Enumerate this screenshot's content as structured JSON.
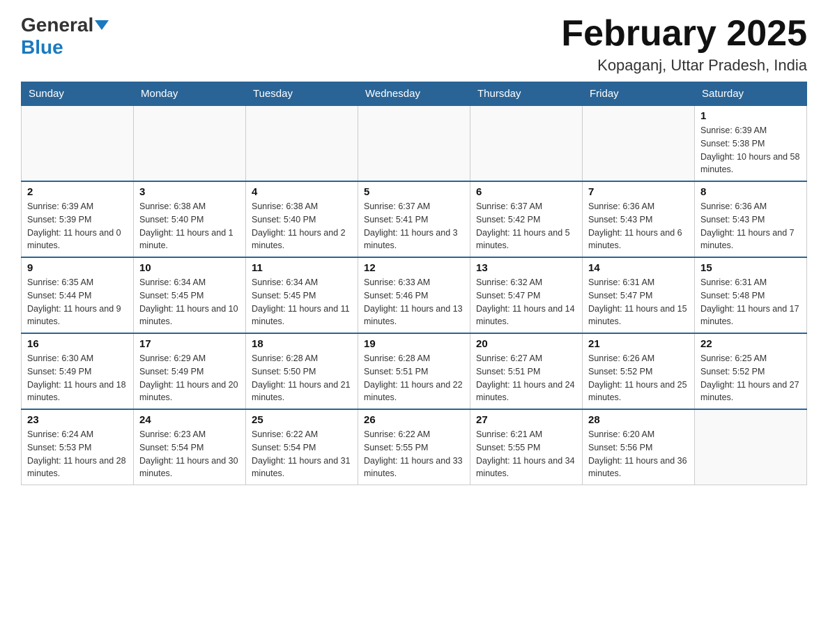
{
  "header": {
    "logo_general": "General",
    "logo_blue": "Blue",
    "month_title": "February 2025",
    "location": "Kopaganj, Uttar Pradesh, India"
  },
  "weekdays": [
    "Sunday",
    "Monday",
    "Tuesday",
    "Wednesday",
    "Thursday",
    "Friday",
    "Saturday"
  ],
  "weeks": [
    [
      {
        "day": "",
        "sunrise": "",
        "sunset": "",
        "daylight": ""
      },
      {
        "day": "",
        "sunrise": "",
        "sunset": "",
        "daylight": ""
      },
      {
        "day": "",
        "sunrise": "",
        "sunset": "",
        "daylight": ""
      },
      {
        "day": "",
        "sunrise": "",
        "sunset": "",
        "daylight": ""
      },
      {
        "day": "",
        "sunrise": "",
        "sunset": "",
        "daylight": ""
      },
      {
        "day": "",
        "sunrise": "",
        "sunset": "",
        "daylight": ""
      },
      {
        "day": "1",
        "sunrise": "Sunrise: 6:39 AM",
        "sunset": "Sunset: 5:38 PM",
        "daylight": "Daylight: 10 hours and 58 minutes."
      }
    ],
    [
      {
        "day": "2",
        "sunrise": "Sunrise: 6:39 AM",
        "sunset": "Sunset: 5:39 PM",
        "daylight": "Daylight: 11 hours and 0 minutes."
      },
      {
        "day": "3",
        "sunrise": "Sunrise: 6:38 AM",
        "sunset": "Sunset: 5:40 PM",
        "daylight": "Daylight: 11 hours and 1 minute."
      },
      {
        "day": "4",
        "sunrise": "Sunrise: 6:38 AM",
        "sunset": "Sunset: 5:40 PM",
        "daylight": "Daylight: 11 hours and 2 minutes."
      },
      {
        "day": "5",
        "sunrise": "Sunrise: 6:37 AM",
        "sunset": "Sunset: 5:41 PM",
        "daylight": "Daylight: 11 hours and 3 minutes."
      },
      {
        "day": "6",
        "sunrise": "Sunrise: 6:37 AM",
        "sunset": "Sunset: 5:42 PM",
        "daylight": "Daylight: 11 hours and 5 minutes."
      },
      {
        "day": "7",
        "sunrise": "Sunrise: 6:36 AM",
        "sunset": "Sunset: 5:43 PM",
        "daylight": "Daylight: 11 hours and 6 minutes."
      },
      {
        "day": "8",
        "sunrise": "Sunrise: 6:36 AM",
        "sunset": "Sunset: 5:43 PM",
        "daylight": "Daylight: 11 hours and 7 minutes."
      }
    ],
    [
      {
        "day": "9",
        "sunrise": "Sunrise: 6:35 AM",
        "sunset": "Sunset: 5:44 PM",
        "daylight": "Daylight: 11 hours and 9 minutes."
      },
      {
        "day": "10",
        "sunrise": "Sunrise: 6:34 AM",
        "sunset": "Sunset: 5:45 PM",
        "daylight": "Daylight: 11 hours and 10 minutes."
      },
      {
        "day": "11",
        "sunrise": "Sunrise: 6:34 AM",
        "sunset": "Sunset: 5:45 PM",
        "daylight": "Daylight: 11 hours and 11 minutes."
      },
      {
        "day": "12",
        "sunrise": "Sunrise: 6:33 AM",
        "sunset": "Sunset: 5:46 PM",
        "daylight": "Daylight: 11 hours and 13 minutes."
      },
      {
        "day": "13",
        "sunrise": "Sunrise: 6:32 AM",
        "sunset": "Sunset: 5:47 PM",
        "daylight": "Daylight: 11 hours and 14 minutes."
      },
      {
        "day": "14",
        "sunrise": "Sunrise: 6:31 AM",
        "sunset": "Sunset: 5:47 PM",
        "daylight": "Daylight: 11 hours and 15 minutes."
      },
      {
        "day": "15",
        "sunrise": "Sunrise: 6:31 AM",
        "sunset": "Sunset: 5:48 PM",
        "daylight": "Daylight: 11 hours and 17 minutes."
      }
    ],
    [
      {
        "day": "16",
        "sunrise": "Sunrise: 6:30 AM",
        "sunset": "Sunset: 5:49 PM",
        "daylight": "Daylight: 11 hours and 18 minutes."
      },
      {
        "day": "17",
        "sunrise": "Sunrise: 6:29 AM",
        "sunset": "Sunset: 5:49 PM",
        "daylight": "Daylight: 11 hours and 20 minutes."
      },
      {
        "day": "18",
        "sunrise": "Sunrise: 6:28 AM",
        "sunset": "Sunset: 5:50 PM",
        "daylight": "Daylight: 11 hours and 21 minutes."
      },
      {
        "day": "19",
        "sunrise": "Sunrise: 6:28 AM",
        "sunset": "Sunset: 5:51 PM",
        "daylight": "Daylight: 11 hours and 22 minutes."
      },
      {
        "day": "20",
        "sunrise": "Sunrise: 6:27 AM",
        "sunset": "Sunset: 5:51 PM",
        "daylight": "Daylight: 11 hours and 24 minutes."
      },
      {
        "day": "21",
        "sunrise": "Sunrise: 6:26 AM",
        "sunset": "Sunset: 5:52 PM",
        "daylight": "Daylight: 11 hours and 25 minutes."
      },
      {
        "day": "22",
        "sunrise": "Sunrise: 6:25 AM",
        "sunset": "Sunset: 5:52 PM",
        "daylight": "Daylight: 11 hours and 27 minutes."
      }
    ],
    [
      {
        "day": "23",
        "sunrise": "Sunrise: 6:24 AM",
        "sunset": "Sunset: 5:53 PM",
        "daylight": "Daylight: 11 hours and 28 minutes."
      },
      {
        "day": "24",
        "sunrise": "Sunrise: 6:23 AM",
        "sunset": "Sunset: 5:54 PM",
        "daylight": "Daylight: 11 hours and 30 minutes."
      },
      {
        "day": "25",
        "sunrise": "Sunrise: 6:22 AM",
        "sunset": "Sunset: 5:54 PM",
        "daylight": "Daylight: 11 hours and 31 minutes."
      },
      {
        "day": "26",
        "sunrise": "Sunrise: 6:22 AM",
        "sunset": "Sunset: 5:55 PM",
        "daylight": "Daylight: 11 hours and 33 minutes."
      },
      {
        "day": "27",
        "sunrise": "Sunrise: 6:21 AM",
        "sunset": "Sunset: 5:55 PM",
        "daylight": "Daylight: 11 hours and 34 minutes."
      },
      {
        "day": "28",
        "sunrise": "Sunrise: 6:20 AM",
        "sunset": "Sunset: 5:56 PM",
        "daylight": "Daylight: 11 hours and 36 minutes."
      },
      {
        "day": "",
        "sunrise": "",
        "sunset": "",
        "daylight": ""
      }
    ]
  ]
}
